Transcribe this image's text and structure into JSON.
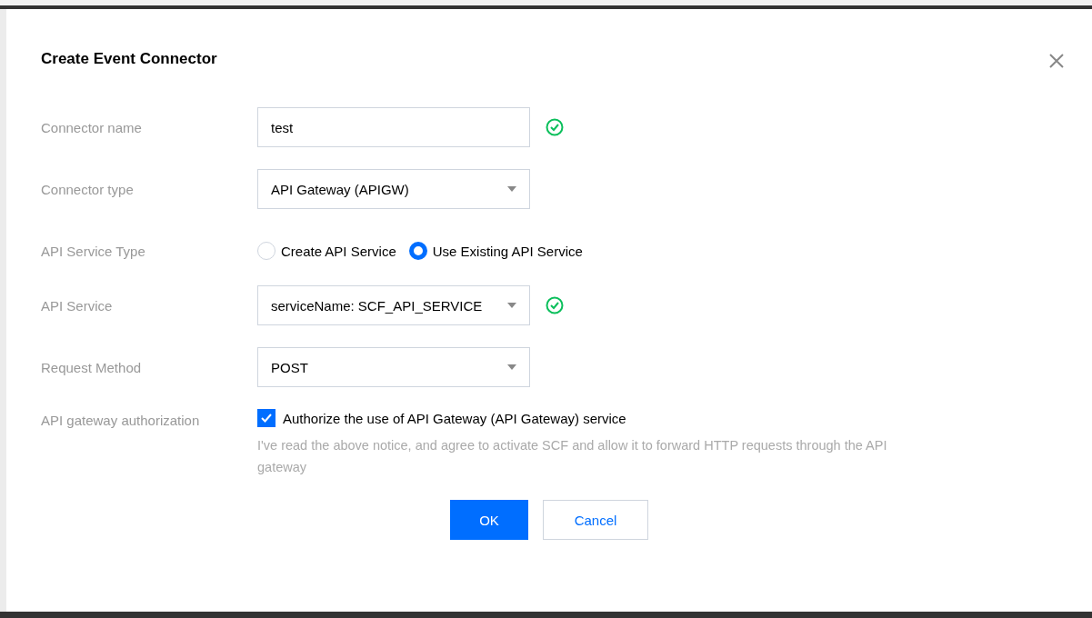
{
  "dialog": {
    "title": "Create Event Connector",
    "fields": [
      {
        "kind": "text",
        "label": "Connector name",
        "value": "test",
        "valid": true
      },
      {
        "kind": "select",
        "label": "Connector type",
        "value": "API Gateway (APIGW)",
        "valid": false
      },
      {
        "kind": "radio",
        "label": "API Service Type",
        "options": [
          {
            "label": "Create API Service",
            "selected": false
          },
          {
            "label": "Use Existing API Service",
            "selected": true
          }
        ]
      },
      {
        "kind": "select",
        "label": "API Service",
        "value": "serviceName: SCF_API_SERVICE",
        "valid": true
      },
      {
        "kind": "select",
        "label": "Request Method",
        "value": "POST",
        "valid": false
      },
      {
        "kind": "checkbox",
        "label": "API gateway authorization",
        "option": "Authorize the use of API Gateway (API Gateway) service",
        "checked": true,
        "note": "I've read the above notice, and agree to activate SCF and allow it to forward HTTP requests through the API gateway"
      }
    ],
    "buttons": [
      {
        "label": "OK",
        "kind": "primary"
      },
      {
        "label": "Cancel",
        "kind": "secondary"
      }
    ]
  }
}
